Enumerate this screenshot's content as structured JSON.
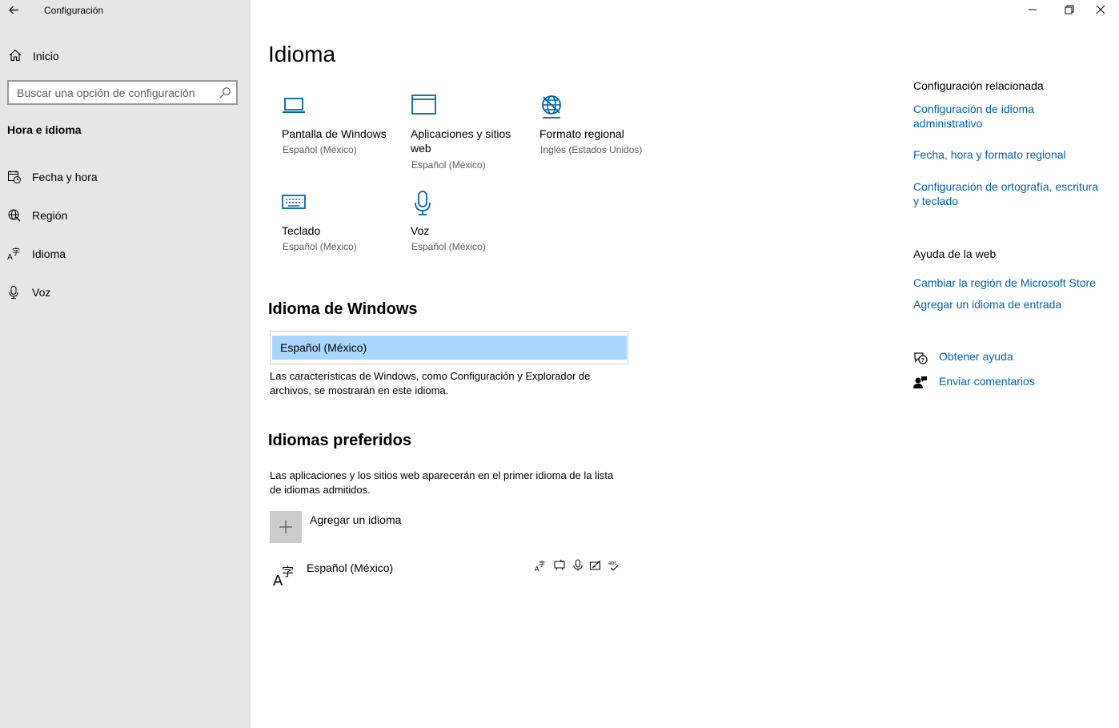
{
  "window": {
    "title": "Configuración",
    "controls": [
      "minimize-icon",
      "restore-icon",
      "close-icon"
    ]
  },
  "sidebar": {
    "home_label": "Inicio",
    "search_placeholder": "Buscar una opción de configuración",
    "section": "Hora e idioma",
    "items": [
      {
        "label": "Fecha y hora",
        "icon": "calendar-clock-icon"
      },
      {
        "label": "Región",
        "icon": "globe-icon"
      },
      {
        "label": "Idioma",
        "icon": "language-icon"
      },
      {
        "label": "Voz",
        "icon": "microphone-icon"
      }
    ]
  },
  "main": {
    "title": "Idioma",
    "tiles": [
      {
        "name": "Pantalla de Windows",
        "value": "Español (México)",
        "icon": "laptop-icon"
      },
      {
        "name": "Aplicaciones y sitios web",
        "value": "Español (México)",
        "icon": "window-icon"
      },
      {
        "name": "Formato regional",
        "value": "Inglés (Estados Unidos)",
        "icon": "globe-format-icon"
      },
      {
        "name": "Teclado",
        "value": "Español (México)",
        "icon": "keyboard-icon"
      },
      {
        "name": "Voz",
        "value": "Español (México)",
        "icon": "microphone-icon"
      }
    ],
    "windows_language": {
      "heading": "Idioma de Windows",
      "selected": "Español (México)",
      "description": "Las características de Windows, como Configuración y Explorador de archivos, se mostrarán en este idioma."
    },
    "preferred": {
      "heading": "Idiomas preferidos",
      "description": "Las aplicaciones y los sitios web aparecerán en el primer idioma de la lista de idiomas admitidos.",
      "add_label": "Agregar un idioma",
      "languages": [
        {
          "name": "Español (México)",
          "features": [
            "display-language-icon",
            "speech-icon",
            "voice-recognition-icon",
            "handwriting-icon",
            "spellcheck-icon"
          ]
        }
      ]
    }
  },
  "related": {
    "heading": "Configuración relacionada",
    "links": [
      "Configuración de idioma administrativo",
      "Fecha, hora y formato regional",
      "Configuración de ortografía, escritura y teclado"
    ]
  },
  "web_help": {
    "heading": "Ayuda de la web",
    "links": [
      "Cambiar la región de Microsoft Store",
      "Agregar un idioma de entrada"
    ]
  },
  "support": {
    "get_help": "Obtener ayuda",
    "feedback": "Enviar comentarios"
  },
  "colors": {
    "accent": "#0063b1",
    "sidebar_bg": "#e6e6e6",
    "selection": "#a9d6fc"
  }
}
